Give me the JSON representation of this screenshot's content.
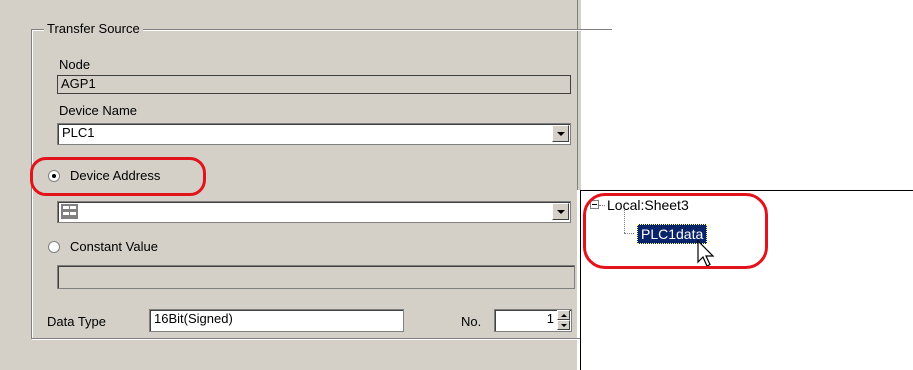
{
  "group": {
    "title": "Transfer Source"
  },
  "node": {
    "label": "Node",
    "value": "AGP1"
  },
  "device_name": {
    "label": "Device Name",
    "value": "PLC1"
  },
  "device_address": {
    "label": "Device Address",
    "value": "",
    "selected": true,
    "icon": "address-picker-icon"
  },
  "constant_value": {
    "label": "Constant Value",
    "value": "",
    "selected": false
  },
  "data_type": {
    "label": "Data Type",
    "value": "16Bit(Signed)"
  },
  "number": {
    "label": "No.",
    "value": "1"
  },
  "tree": {
    "root_label": "Local:Sheet3",
    "root_expander": "⊟",
    "child_label": "PLC1data"
  },
  "colors": {
    "highlight": "#e3131b",
    "selection": "#0a246a",
    "panel": "#d4d0c8"
  }
}
